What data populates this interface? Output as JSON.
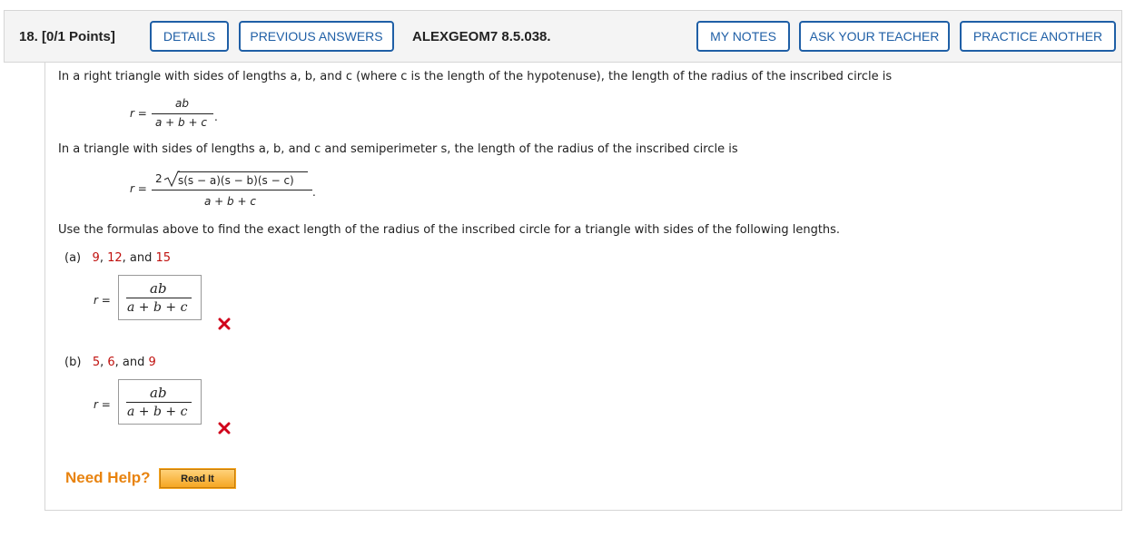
{
  "header": {
    "question_label": "18.  [0/1 Points]",
    "buttons": {
      "details": "DETAILS",
      "previous_answers": "PREVIOUS ANSWERS",
      "my_notes": "MY NOTES",
      "ask_teacher": "ASK YOUR TEACHER",
      "practice_another": "PRACTICE ANOTHER"
    },
    "assignment_id": "ALEXGEOM7 8.5.038."
  },
  "problem": {
    "intro1": "In a right triangle with sides of lengths a, b, and c (where c is the length of the hypotenuse), the length of the radius of the inscribed circle is",
    "formula1": {
      "lhs": "r =",
      "numerator": "ab",
      "denominator": "a + b + c"
    },
    "intro2": "In a triangle with sides of lengths a, b, and c and semiperimeter s, the length of the radius of the inscribed circle is",
    "formula2": {
      "lhs": "r =",
      "coef": "2",
      "radicand": "s(s − a)(s − b)(s − c)",
      "denominator": "a + b + c"
    },
    "instruction": "Use the formulas above to find the exact length of the radius of the inscribed circle for a triangle with sides of the following lengths.",
    "parts": [
      {
        "label": "(a)",
        "s1": "9",
        "s2": "12",
        "s3": "15",
        "sep1": ",",
        "sep2": ", and",
        "answer": {
          "lhs": "r =",
          "numerator": "ab",
          "denominator": "a + b + c"
        },
        "status": "incorrect"
      },
      {
        "label": "(b)",
        "s1": "5",
        "s2": "6",
        "s3": "9",
        "sep1": ",",
        "sep2": ", and",
        "answer": {
          "lhs": "r =",
          "numerator": "ab",
          "denominator": "a + b + c"
        },
        "status": "incorrect"
      }
    ]
  },
  "help": {
    "label": "Need Help?",
    "read_it": "Read It"
  },
  "colors": {
    "accent": "#1f5fa6",
    "given_values": "#c0110e",
    "incorrect": "#d0021b",
    "help": "#e8830f"
  },
  "icons": {
    "incorrect": "x-mark-icon"
  }
}
